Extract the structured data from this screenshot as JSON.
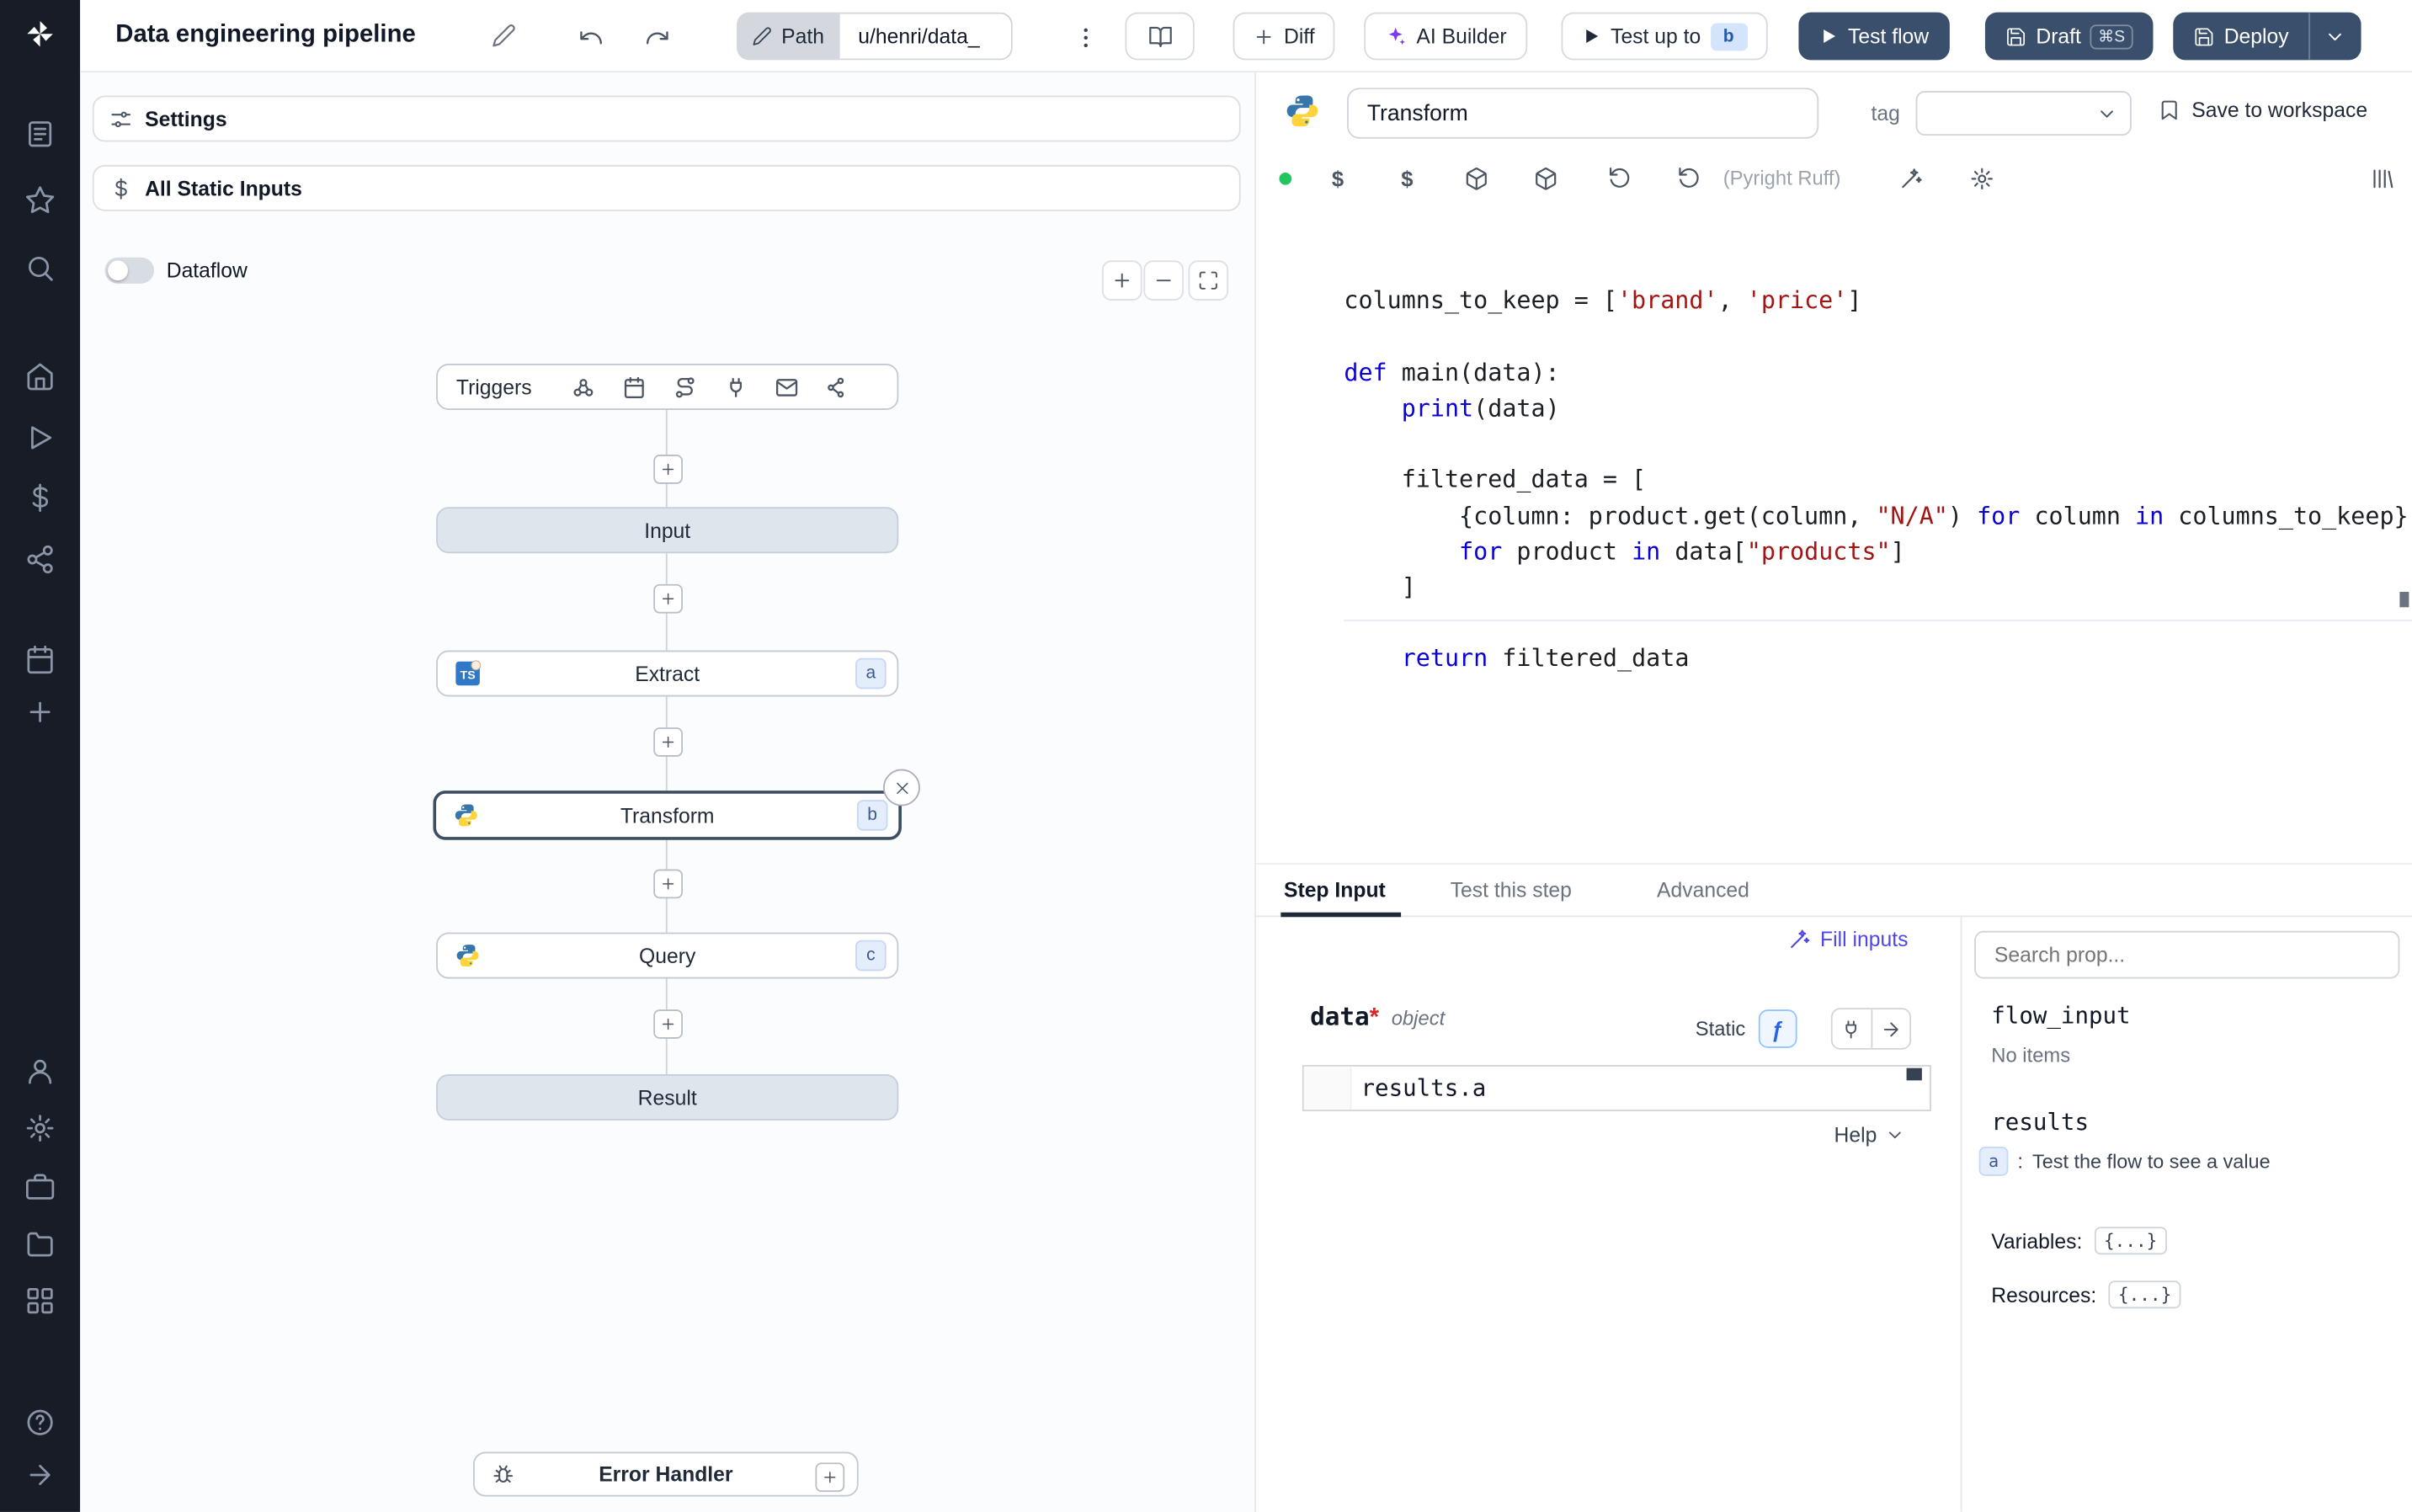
{
  "topbar": {
    "title": "Data engineering pipeline",
    "path_button": "Path",
    "path_value": "u/henri/data_",
    "diff_button": "Diff",
    "ai_builder_button": "AI Builder",
    "test_up_to_button": "Test up to",
    "test_up_to_badge": "b",
    "test_flow_button": "Test flow",
    "draft_button": "Draft",
    "draft_shortcut": "⌘S",
    "deploy_button": "Deploy"
  },
  "flow_panel": {
    "settings_button": "Settings",
    "all_static_inputs_button": "All Static Inputs",
    "dataflow_toggle_label": "Dataflow",
    "triggers_label": "Triggers",
    "graph": {
      "input": {
        "label": "Input"
      },
      "extract": {
        "label": "Extract",
        "badge": "a"
      },
      "transform": {
        "label": "Transform",
        "badge": "b"
      },
      "query": {
        "label": "Query",
        "badge": "c"
      },
      "result": {
        "label": "Result"
      }
    },
    "error_handler_label": "Error Handler"
  },
  "editor": {
    "step_name_value": "Transform",
    "tag_label": "tag",
    "save_to_workspace_button": "Save to workspace",
    "lint_status": "(Pyright Ruff)",
    "code": [
      [
        [
          "d",
          "columns_to_keep = ["
        ],
        [
          "s",
          "'brand'"
        ],
        [
          "d",
          ", "
        ],
        [
          "s",
          "'price'"
        ],
        [
          "d",
          "]"
        ]
      ],
      [],
      [
        [
          "k",
          "def"
        ],
        [
          "d",
          " main(data):"
        ]
      ],
      [
        [
          "d",
          "    "
        ],
        [
          "k",
          "print"
        ],
        [
          "d",
          "(data)"
        ]
      ],
      [],
      [
        [
          "d",
          "    filtered_data = ["
        ]
      ],
      [
        [
          "d",
          "        {column: product.get(column, "
        ],
        [
          "s",
          "\"N/A\""
        ],
        [
          "d",
          ") "
        ],
        [
          "k",
          "for"
        ],
        [
          "d",
          " column "
        ],
        [
          "k",
          "in"
        ],
        [
          "d",
          " columns_to_keep}"
        ]
      ],
      [
        [
          "d",
          "        "
        ],
        [
          "k",
          "for"
        ],
        [
          "d",
          " product "
        ],
        [
          "k",
          "in"
        ],
        [
          "d",
          " data["
        ],
        [
          "s",
          "\"products\""
        ],
        [
          "d",
          "]"
        ]
      ],
      [
        [
          "d",
          "    ]"
        ]
      ],
      [],
      [
        [
          "d",
          "    "
        ],
        [
          "k",
          "return"
        ],
        [
          "d",
          " filtered_data"
        ]
      ]
    ]
  },
  "step_panel": {
    "tabs": [
      {
        "label": "Step Input"
      },
      {
        "label": "Test this step"
      },
      {
        "label": "Advanced"
      }
    ],
    "fill_inputs_button": "Fill inputs",
    "arg": {
      "name": "data",
      "required_marker": "*",
      "type": "object",
      "static_label": "Static",
      "expression": "results.a",
      "help_label": "Help"
    }
  },
  "props_panel": {
    "search_placeholder": "Search prop...",
    "flow_input_label": "flow_input",
    "flow_input_empty": "No items",
    "results_label": "results",
    "result_badge": "a",
    "result_separator": ":",
    "result_hint": "Test the flow to see a value",
    "variables_label": "Variables:",
    "variables_value": "{...}",
    "resources_label": "Resources:",
    "resources_value": "{...}"
  },
  "colors": {
    "accent_blue": "#2563eb",
    "dark_button": "#3a4f6c",
    "sidebar_bg": "#171c26",
    "badge_blue_bg": "#e4edfb",
    "fill_inputs_link": "#4f46e5",
    "status_dot_green": "#22c55e"
  }
}
